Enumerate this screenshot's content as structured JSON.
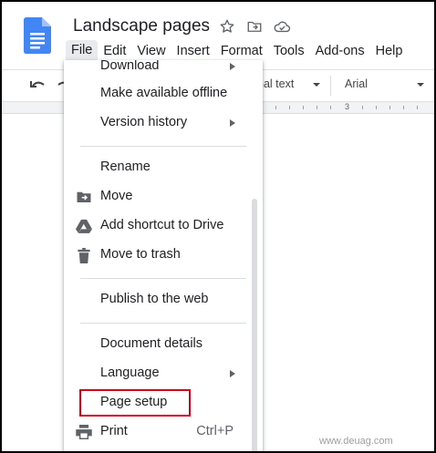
{
  "doc": {
    "title": "Landscape pages"
  },
  "menubar": [
    "File",
    "Edit",
    "View",
    "Insert",
    "Format",
    "Tools",
    "Add-ons",
    "Help"
  ],
  "toolbar": {
    "style": "Normal text",
    "style_visible": "nal text",
    "font": "Arial"
  },
  "ruler": {
    "mark": "3"
  },
  "file_menu": {
    "items": [
      {
        "label": "Download",
        "submenu": true
      },
      {
        "label": "Make available offline"
      },
      {
        "label": "Version history",
        "submenu": true
      },
      {
        "label": "Rename"
      },
      {
        "label": "Move",
        "icon": "move-folder-icon"
      },
      {
        "label": "Add shortcut to Drive",
        "icon": "drive-shortcut-icon"
      },
      {
        "label": "Move to trash",
        "icon": "trash-icon"
      },
      {
        "label": "Publish to the web"
      },
      {
        "label": "Document details"
      },
      {
        "label": "Language",
        "submenu": true
      },
      {
        "label": "Page setup",
        "highlighted": true
      },
      {
        "label": "Print",
        "icon": "printer-icon",
        "shortcut": "Ctrl+P"
      }
    ]
  },
  "watermark": "www.deuag.com",
  "colors": {
    "brand_blue": "#4285f4",
    "highlight_red": "#d0021b"
  }
}
